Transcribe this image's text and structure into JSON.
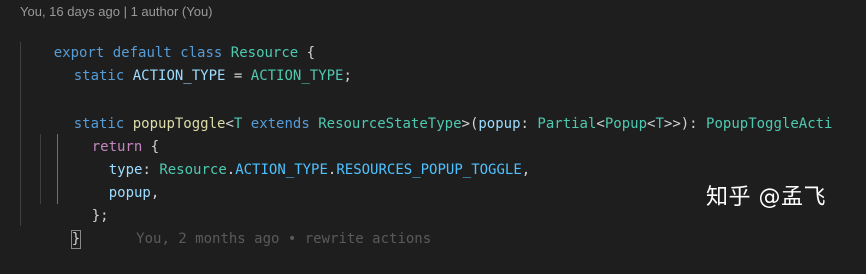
{
  "codelens": "You, 16 days ago | 1 author (You)",
  "code": {
    "l1": {
      "export": "export",
      "default": "default",
      "class": "class",
      "name": "Resource",
      "brace": "{"
    },
    "l2": {
      "static": "static",
      "prop": "ACTION_TYPE",
      "eq": "=",
      "value": "ACTION_TYPE",
      "semi": ";"
    },
    "l4": {
      "static": "static",
      "method": "popupToggle",
      "lt": "<",
      "tparam": "T",
      "extends": "extends",
      "constraint": "ResourceStateType",
      "gt_paren": ">(",
      "param": "popup",
      "colon": ":",
      "ptype": "Partial",
      "lt2": "<",
      "ptype2": "Popup",
      "lt3": "<",
      "tparam2": "T",
      "close": ">>):",
      "rtype": "PopupToggleActi"
    },
    "l5": {
      "return": "return",
      "brace": "{"
    },
    "l6": {
      "key": "type",
      "colon": ":",
      "obj": "Resource",
      "dot1": ".",
      "p1": "ACTION_TYPE",
      "dot2": ".",
      "p2": "RESOURCES_POPUP_TOGGLE",
      "comma": ","
    },
    "l7": {
      "key": "popup",
      "comma": ","
    },
    "l8": {
      "close": "};"
    },
    "l9": {
      "close": "}",
      "blame": "You, 2 months ago • rewrite actions"
    }
  },
  "watermark": "知乎 @孟飞",
  "colors": {
    "background": "#1e1e1e",
    "keyword": "#569cd6",
    "control": "#c586c0",
    "type": "#4ec9b0",
    "function": "#dcdcaa",
    "variable": "#9cdcfe",
    "constant": "#4fc1ff"
  }
}
